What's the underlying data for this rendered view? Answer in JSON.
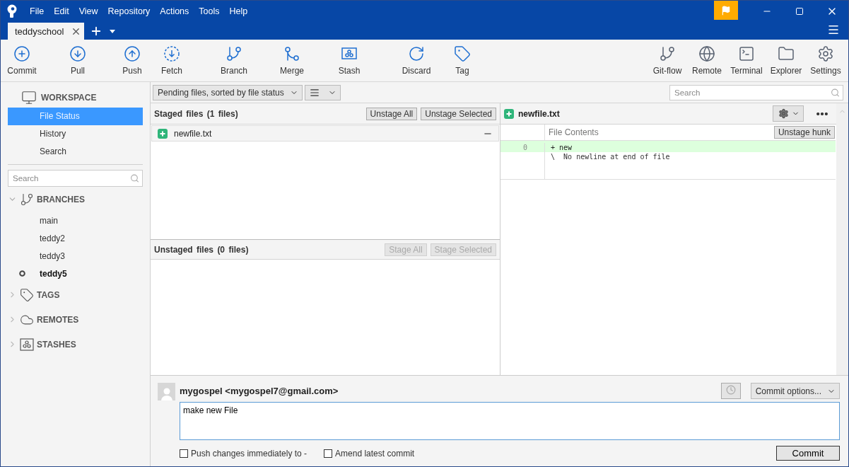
{
  "menu": [
    "File",
    "Edit",
    "View",
    "Repository",
    "Actions",
    "Tools",
    "Help"
  ],
  "tabs": [
    {
      "label": "teddyschool",
      "selected": true
    }
  ],
  "toolbar": {
    "left": [
      {
        "label": "Commit",
        "kind": "commit"
      },
      {
        "label": "Pull",
        "kind": "pull"
      },
      {
        "label": "Push",
        "kind": "push"
      },
      {
        "label": "Fetch",
        "kind": "fetch"
      },
      {
        "label": "Branch",
        "kind": "branch"
      },
      {
        "label": "Merge",
        "kind": "merge"
      },
      {
        "label": "Stash",
        "kind": "stash"
      },
      {
        "label": "Discard",
        "kind": "discard"
      },
      {
        "label": "Tag",
        "kind": "tag"
      }
    ],
    "right": [
      {
        "label": "Git-flow",
        "kind": "gitflow"
      },
      {
        "label": "Remote",
        "kind": "remote"
      },
      {
        "label": "Terminal",
        "kind": "terminal"
      },
      {
        "label": "Explorer",
        "kind": "explorer"
      },
      {
        "label": "Settings",
        "kind": "settings"
      }
    ]
  },
  "sidebar": {
    "workspace": "WORKSPACE",
    "items": [
      {
        "label": "File Status",
        "selected": true
      },
      {
        "label": "History",
        "selected": false
      },
      {
        "label": "Search",
        "selected": false
      }
    ],
    "search": {
      "placeholder": "Search"
    },
    "sections": [
      {
        "title": "BRANCHES",
        "kind": "branches",
        "expanded": true,
        "children": [
          {
            "label": "main",
            "current": false
          },
          {
            "label": "teddy2",
            "current": false
          },
          {
            "label": "teddy3",
            "current": false
          },
          {
            "label": "teddy5",
            "current": true
          }
        ]
      },
      {
        "title": "TAGS",
        "kind": "tags",
        "expanded": false
      },
      {
        "title": "REMOTES",
        "kind": "remotes",
        "expanded": false
      },
      {
        "title": "STASHES",
        "kind": "stashes",
        "expanded": false
      }
    ]
  },
  "filter": {
    "sort": "Pending files, sorted by file status",
    "search": {
      "placeholder": "Search"
    }
  },
  "staged": {
    "title": "Staged files",
    "count": "(1 files)",
    "buttons": [
      {
        "label": "Unstage All",
        "disabled": false
      },
      {
        "label": "Unstage Selected",
        "disabled": false
      }
    ],
    "files": [
      {
        "name": "newfile.txt",
        "added": true
      }
    ]
  },
  "unstaged": {
    "title": "Unstaged files",
    "count": "(0 files)",
    "buttons": [
      {
        "label": "Stage All",
        "disabled": true
      },
      {
        "label": "Stage Selected",
        "disabled": true
      }
    ]
  },
  "diff": {
    "file": "newfile.txt",
    "added": true,
    "header": "File Contents",
    "hunk_button": "Unstage hunk",
    "lines": [
      {
        "number": "0",
        "text": " + new",
        "kind": "added"
      },
      {
        "text": " \\  No newline at end of file",
        "kind": "info"
      }
    ]
  },
  "commit": {
    "author": "mygospel <mygospel7@gmail.com>",
    "message": "make new File",
    "options": "Commit options...",
    "checkboxes": [
      {
        "label": "Push changes immediately to -",
        "checked": false
      },
      {
        "label": "Amend latest commit",
        "checked": false
      }
    ],
    "button": "Commit"
  }
}
